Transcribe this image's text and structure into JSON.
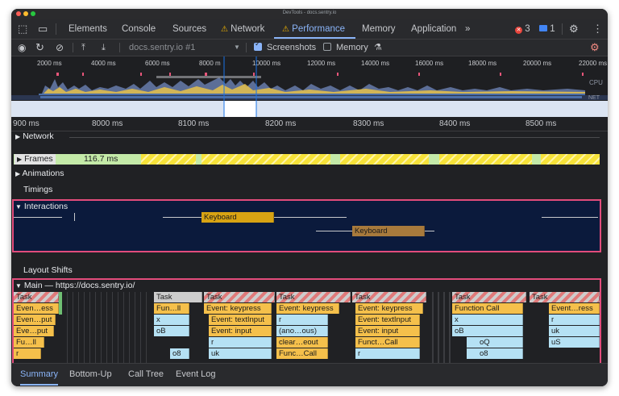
{
  "window": {
    "title": "DevTools - docs.sentry.io"
  },
  "tabs": [
    {
      "label": "Elements"
    },
    {
      "label": "Console"
    },
    {
      "label": "Sources"
    },
    {
      "label": "Network"
    },
    {
      "label": "Performance"
    },
    {
      "label": "Memory"
    },
    {
      "label": "Application"
    }
  ],
  "status": {
    "errors": "3",
    "messages": "1"
  },
  "toolbar": {
    "profile_select": "docs.sentry.io #1",
    "screenshots_label": "Screenshots",
    "memory_label": "Memory"
  },
  "overview": {
    "ticks": [
      "2000 ms",
      "4000 ms",
      "6000 ms",
      "8000 m",
      "10000 ms",
      "12000 ms",
      "14000 ms",
      "16000 ms",
      "18000 ms",
      "20000 ms",
      "22000 ms"
    ],
    "cpu_label": "CPU",
    "net_label": "NET"
  },
  "ruler": {
    "ticks": [
      "900 ms",
      "8000 ms",
      "8100 ms",
      "8200 ms",
      "8300 ms",
      "8400 ms",
      "8500 ms"
    ]
  },
  "tracks": {
    "network": "Network",
    "frames": "Frames",
    "frame_time": "116.7 ms",
    "animations": "Animations",
    "timings": "Timings",
    "interactions": "Interactions",
    "interaction_1": "Keyboard",
    "interaction_2": "Keyboard",
    "layout_shifts": "Layout Shifts",
    "main": "Main — https://docs.sentry.io/"
  },
  "flame": {
    "t": "Task",
    "c1": [
      "Even…ess",
      "Even…put",
      "Eve…put",
      "Fu…ll",
      "r"
    ],
    "c2": [
      "Fun…ll",
      "x",
      "oB",
      "o8"
    ],
    "c3": [
      "Event: keypress",
      "Event: textInput",
      "Event: input",
      "r",
      "uk"
    ],
    "c4": [
      "Event: keypress",
      "r",
      "(ano…ous)",
      "clear…eout",
      "Func…Call"
    ],
    "c5": [
      "Event: keypress",
      "Event: textInput",
      "Event: input",
      "Funct…Call",
      "r"
    ],
    "c6": [
      "Function Call",
      "x",
      "oB",
      "oQ",
      "o8"
    ],
    "c7": [
      "Event…ress",
      "r",
      "uk",
      "uS"
    ]
  },
  "bottom_tabs": [
    "Summary",
    "Bottom-Up",
    "Call Tree",
    "Event Log"
  ],
  "colors": {
    "accent": "#8ab4f8",
    "highlight": "#e24c7b",
    "scripting": "#f5c04b",
    "frames": "#c4eaa8"
  }
}
